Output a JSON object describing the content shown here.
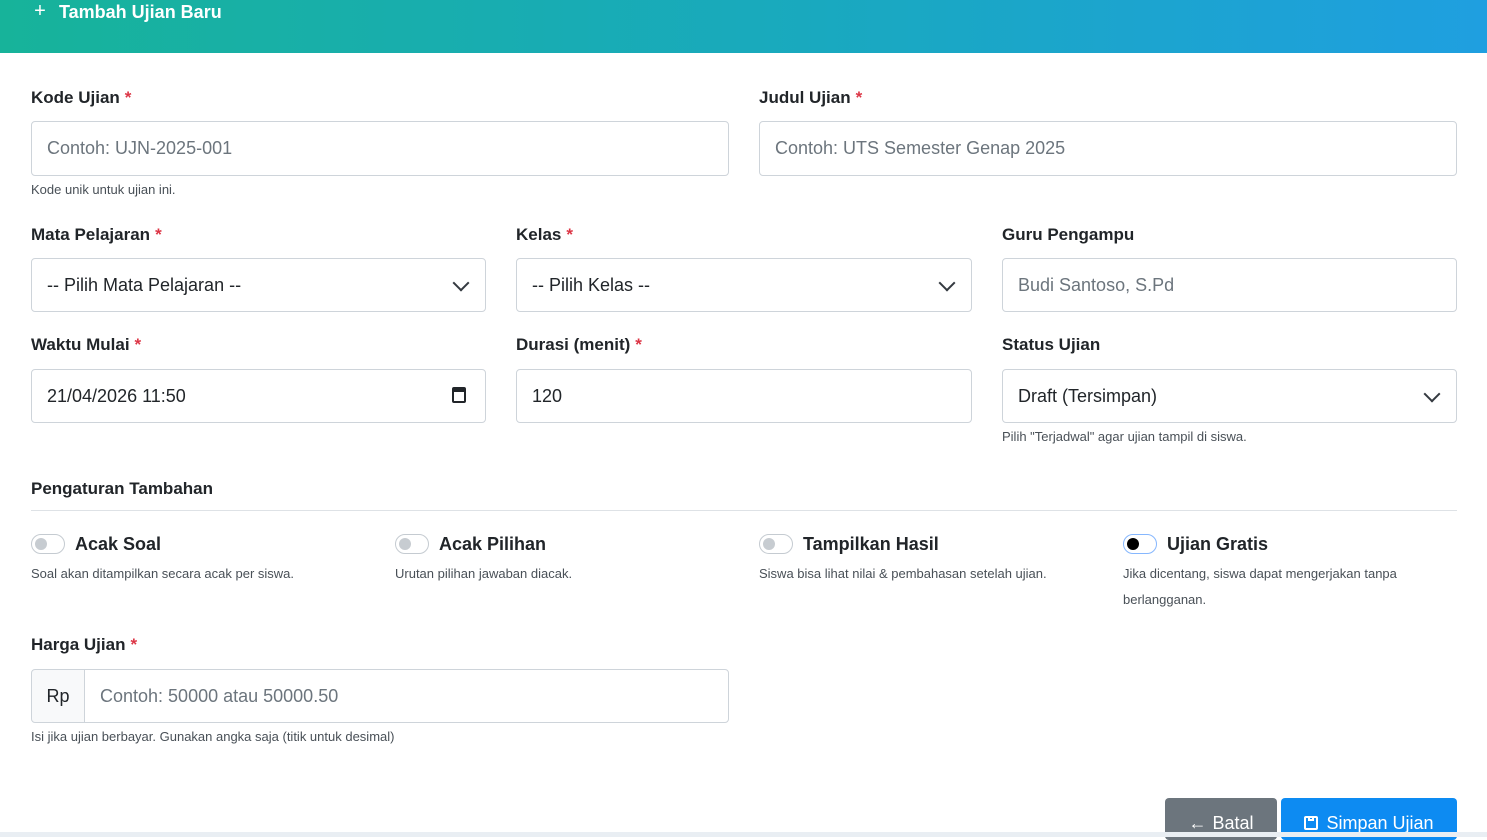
{
  "header": {
    "title": "Tambah Ujian Baru"
  },
  "form": {
    "kode": {
      "label": "Kode Ujian",
      "placeholder": "Contoh: UJN-2025-001",
      "help": "Kode unik untuk ujian ini."
    },
    "judul": {
      "label": "Judul Ujian",
      "placeholder": "Contoh: UTS Semester Genap 2025"
    },
    "mapel": {
      "label": "Mata Pelajaran",
      "value": "-- Pilih Mata Pelajaran --"
    },
    "kelas": {
      "label": "Kelas",
      "value": "-- Pilih Kelas --"
    },
    "guru": {
      "label": "Guru Pengampu",
      "value": "Budi Santoso, S.Pd"
    },
    "waktu": {
      "label": "Waktu Mulai",
      "value": "21/04/2026 11:50"
    },
    "durasi": {
      "label": "Durasi (menit)",
      "value": "120"
    },
    "status": {
      "label": "Status Ujian",
      "value": "Draft (Tersimpan)",
      "help": "Pilih \"Terjadwal\" agar ujian tampil di siswa."
    },
    "required_mark": "*"
  },
  "settings": {
    "title": "Pengaturan Tambahan",
    "options": [
      {
        "label": "Acak Soal",
        "help": "Soal akan ditampilkan secara acak per siswa.",
        "checked": false
      },
      {
        "label": "Acak Pilihan",
        "help": "Urutan pilihan jawaban diacak.",
        "checked": false
      },
      {
        "label": "Tampilkan Hasil",
        "help": "Siswa bisa lihat nilai & pembahasan setelah ujian.",
        "checked": false
      },
      {
        "label": "Ujian Gratis",
        "help": "Jika dicentang, siswa dapat mengerjakan tanpa berlangganan.",
        "checked": true
      }
    ]
  },
  "harga": {
    "label": "Harga Ujian",
    "prefix": "Rp",
    "placeholder": "Contoh: 50000 atau 50000.50",
    "help": "Isi jika ujian berbayar. Gunakan angka saja (titik untuk desimal)"
  },
  "actions": {
    "cancel": "Batal",
    "save": "Simpan Ujian"
  }
}
